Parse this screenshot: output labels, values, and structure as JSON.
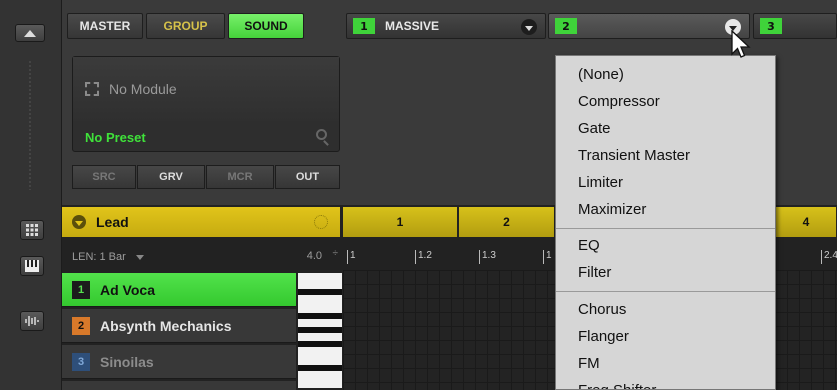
{
  "tabs": {
    "master": "MASTER",
    "group": "GROUP",
    "sound": "SOUND"
  },
  "slots": [
    {
      "number": "1",
      "name": "MASSIVE"
    },
    {
      "number": "2",
      "name": ""
    },
    {
      "number": "3",
      "name": ""
    }
  ],
  "module": {
    "placeholder": "No Module",
    "preset": "No Preset"
  },
  "routing": {
    "src": "SRC",
    "grv": "GRV",
    "mcr": "MCR",
    "out": "OUT"
  },
  "group": {
    "name": "Lead"
  },
  "patterns": [
    "1",
    "2",
    "4"
  ],
  "length": {
    "label": "LEN: 1 Bar",
    "value": "4.0",
    "step": "÷"
  },
  "ruler": [
    "1",
    "1.2",
    "1.3",
    "1",
    "2.4"
  ],
  "sounds": [
    {
      "number": "1",
      "name": "Ad Voca"
    },
    {
      "number": "2",
      "name": "Absynth Mechanics"
    },
    {
      "number": "3",
      "name": "Sinoilas"
    }
  ],
  "fx_menu": {
    "items": [
      "(None)",
      "Compressor",
      "Gate",
      "Transient Master",
      "Limiter",
      "Maximizer",
      "EQ",
      "Filter",
      "Chorus",
      "Flanger",
      "FM",
      "Freq Shifter"
    ]
  },
  "colors": {
    "sound_green": "#3fd33a",
    "group_yellow": "#e1c41a",
    "menu_bg": "#d6d6d6"
  }
}
